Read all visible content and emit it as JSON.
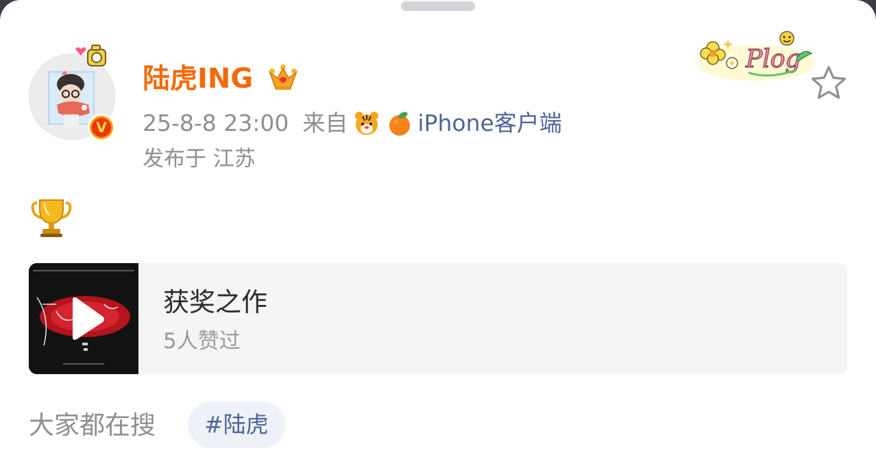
{
  "post": {
    "username": "陆虎ING",
    "time": "25-8-8 23:00",
    "source_prefix": "来自",
    "client": "iPhone客户端",
    "location": "发布于 江苏",
    "content_emoji": "trophy-icon",
    "header_sticker_text": "Plog"
  },
  "video_card": {
    "title": "获奖之作",
    "likes": "5人赞过"
  },
  "search": {
    "label": "大家都在搜",
    "hashtag": "#陆虎"
  },
  "colors": {
    "username": "#f26b0a",
    "link": "#4d6596",
    "meta": "#8e8e93",
    "card_bg": "#f5f5f5",
    "chip_bg": "#eef1f7"
  }
}
